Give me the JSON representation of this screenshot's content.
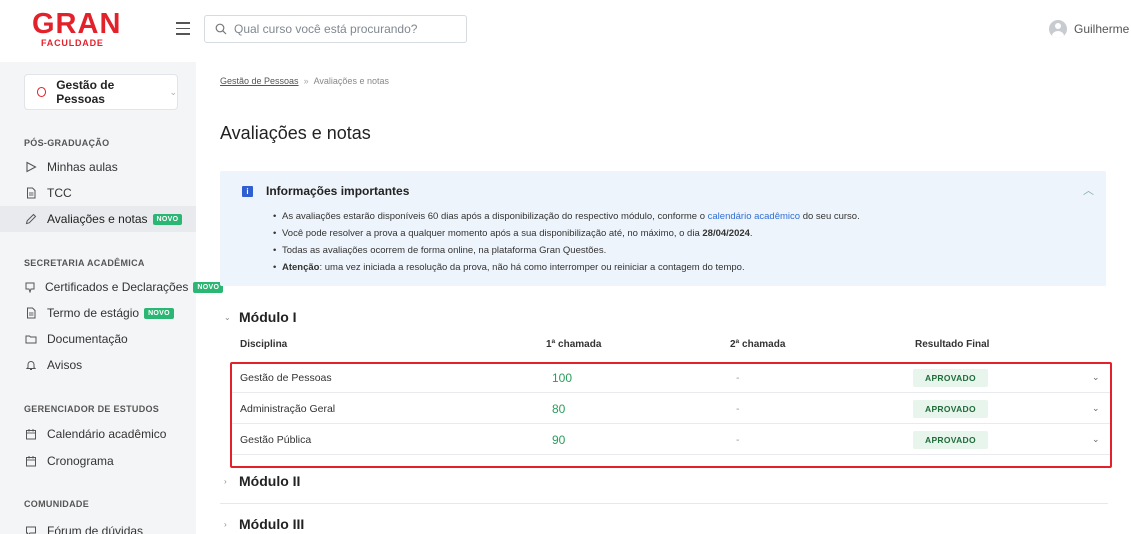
{
  "brand": {
    "name": "GRAN",
    "subtitle": "FACULDADE",
    "color": "#e3212b"
  },
  "header": {
    "search_placeholder": "Qual curso você está procurando?",
    "user_name": "Guilherme"
  },
  "sidebar": {
    "course": "Gestão de Pessoas",
    "sections": [
      {
        "title": "PÓS-GRADUAÇÃO"
      },
      {
        "title": "SECRETARIA ACADÊMICA"
      },
      {
        "title": "GERENCIADOR DE ESTUDOS"
      },
      {
        "title": "COMUNIDADE"
      }
    ],
    "items": [
      {
        "label": "Minhas aulas",
        "icon": "play-icon"
      },
      {
        "label": "TCC",
        "icon": "document-icon"
      },
      {
        "label": "Avaliações e notas",
        "icon": "pencil-icon",
        "badge": "NOVO",
        "active": true
      },
      {
        "label": "Certificados e Declarações",
        "icon": "certificate-icon",
        "badge": "NOVO"
      },
      {
        "label": "Termo de estágio",
        "icon": "document-icon",
        "badge": "NOVO"
      },
      {
        "label": "Documentação",
        "icon": "folder-icon"
      },
      {
        "label": "Avisos",
        "icon": "bell-icon"
      },
      {
        "label": "Calendário acadêmico",
        "icon": "calendar-icon"
      },
      {
        "label": "Cronograma",
        "icon": "calendar-icon"
      },
      {
        "label": "Fórum de dúvidas",
        "icon": "chat-icon"
      }
    ],
    "badge_color": "#2bb673"
  },
  "breadcrumb": {
    "parent": "Gestão de Pessoas",
    "separator": "»",
    "current": "Avaliações e notas"
  },
  "page": {
    "title": "Avaliações e notas"
  },
  "info": {
    "title": "Informações importantes",
    "items": [
      {
        "before": "As avaliações estarão disponíveis 60 dias após a disponibilização do respectivo módulo, conforme o ",
        "link": "calendário acadêmico",
        "after": " do seu curso."
      },
      {
        "before": "Você pode resolver a prova a qualquer momento após a sua disponibilização até, no máximo, o dia ",
        "bold": "28/04/2024",
        "after": "."
      },
      {
        "text": "Todas as avaliações ocorrem de forma online, na plataforma Gran Questões."
      },
      {
        "bold": "Atenção",
        "after": ": uma vez iniciada a resolução da prova, não há como interromper ou reiniciar a contagem do tempo."
      }
    ],
    "link_color": "#2f6fd6"
  },
  "modules": [
    {
      "title": "Módulo I",
      "expanded": true
    },
    {
      "title": "Módulo II",
      "expanded": false
    },
    {
      "title": "Módulo III",
      "expanded": false
    }
  ],
  "table": {
    "headers": [
      "Disciplina",
      "1ª chamada",
      "2ª chamada",
      "Resultado Final"
    ],
    "rows": [
      {
        "discipline": "Gestão de Pessoas",
        "first": "100",
        "second": "-",
        "result": "APROVADO"
      },
      {
        "discipline": "Administração Geral",
        "first": "80",
        "second": "-",
        "result": "APROVADO"
      },
      {
        "discipline": "Gestão Pública",
        "first": "90",
        "second": "-",
        "result": "APROVADO"
      }
    ],
    "grade_color": "#2a9d5c",
    "highlight_color": "#e3212b"
  }
}
